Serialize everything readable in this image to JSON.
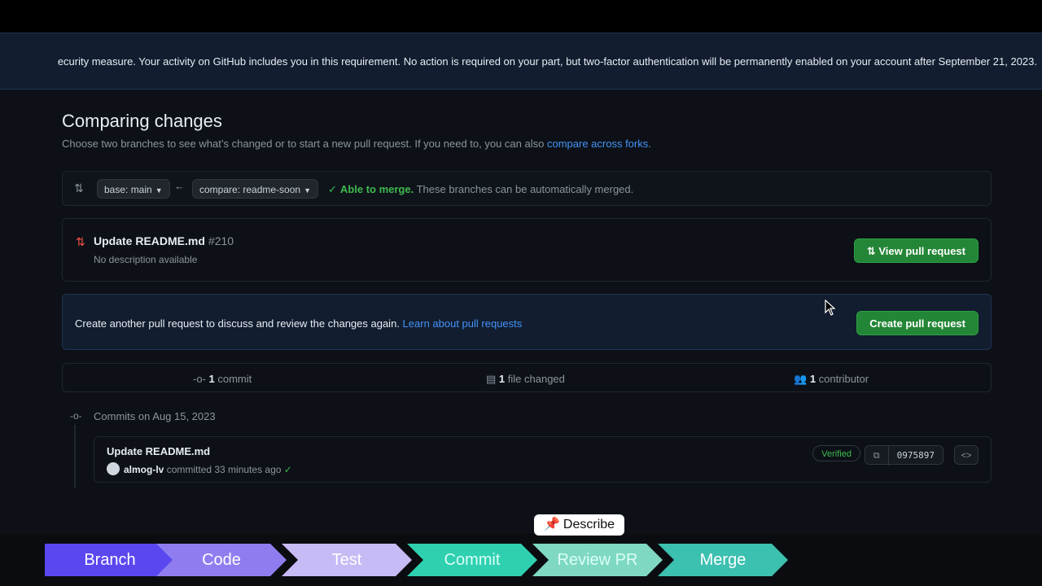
{
  "banner": {
    "text": "ecurity measure. Your activity on GitHub includes you in this requirement. No action is required on your part, but two-factor authentication will be permanently enabled on your account after September 21, 2023."
  },
  "compare": {
    "title": "Comparing changes",
    "subtitle": "Choose two branches to see what’s changed or to start a new pull request. If you need to, you can also",
    "subtitle_link": "compare across forks",
    "subtitle_end": ".",
    "base_label": "base: main",
    "compare_label": "compare: readme-soon",
    "merge_status": "Able to merge.",
    "merge_detail": "These branches can be automatically merged."
  },
  "pr": {
    "title": "Update README.md",
    "number": "#210",
    "description": "No description available",
    "view_button": "View pull request"
  },
  "create": {
    "text": "Create another pull request to discuss and review the changes again.",
    "link": "Learn about pull requests",
    "button": "Create pull request"
  },
  "stats": {
    "commits_count": "1",
    "commits_label": "commit",
    "files_count": "1",
    "files_label": "file changed",
    "contributors_count": "1",
    "contributors_label": "contributor"
  },
  "commits": {
    "heading": "Commits on Aug 15, 2023",
    "items": [
      {
        "title": "Update README.md",
        "author": "almog-lv",
        "meta": "committed 33 minutes ago",
        "badge": "Verified",
        "sha": "0975897"
      }
    ]
  },
  "overlay": {
    "describe_label": "Describe",
    "steps": [
      "Branch",
      "Code",
      "Test",
      "Commit",
      "Review PR",
      "Merge"
    ],
    "step_colors": [
      "#5b47f0",
      "#8f7df0",
      "#c7baf5",
      "#2fd0b0",
      "#7fd8c2",
      "#3cc0b0"
    ],
    "step_text_colors": [
      "#ffffff",
      "#ffffff",
      "#ffffff",
      "#d9fff6",
      "#d9fff6",
      "#ffffff"
    ]
  }
}
